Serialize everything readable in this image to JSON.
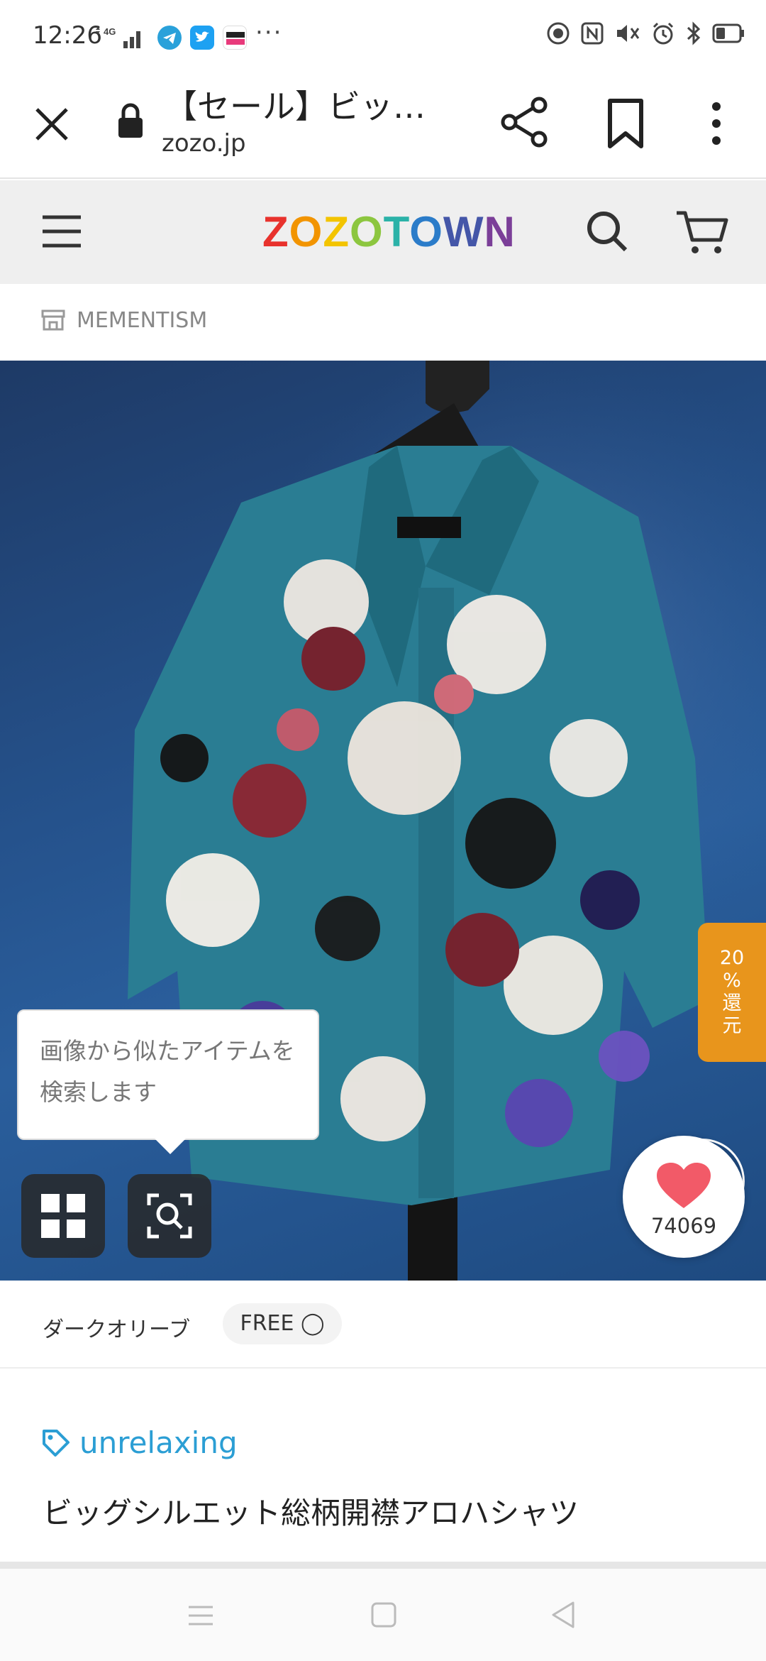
{
  "status_bar": {
    "time": "12:26",
    "network": "4G",
    "overflow": "···",
    "icons_left": [
      "signal-icon",
      "telegram-icon",
      "twitter-icon",
      "dmm-icon"
    ],
    "icons_right": [
      "data-saver-icon",
      "nfc-icon",
      "mute-icon",
      "alarm-icon",
      "bluetooth-icon",
      "battery-icon"
    ]
  },
  "browser": {
    "title": "【セール】ビッ…",
    "url": "zozo.jp"
  },
  "site_header": {
    "logo_letters": [
      "Z",
      "O",
      "Z",
      "O",
      "T",
      "O",
      "W",
      "N"
    ],
    "logo_colors": [
      "#e8322d",
      "#f29400",
      "#f3c400",
      "#8cc63f",
      "#2bb2a8",
      "#2b7cc9",
      "#4456a8",
      "#7b3f98"
    ]
  },
  "brand_row": {
    "shop_name": "MEMENTISM"
  },
  "product_image": {
    "cashback": [
      "20",
      "%",
      "還",
      "元"
    ],
    "tooltip": "画像から似たアイテムを検索します",
    "like_count": "74069",
    "accent_color": "#f25a68",
    "cashback_color": "#e8951c"
  },
  "variant": {
    "color_name": "ダークオリーブ",
    "size_label": "FREE ◯"
  },
  "product_info": {
    "brand": "unrelaxing",
    "name": "ビッグシルエット総柄開襟アロハシャツ",
    "brand_color": "#2b9ed4"
  }
}
